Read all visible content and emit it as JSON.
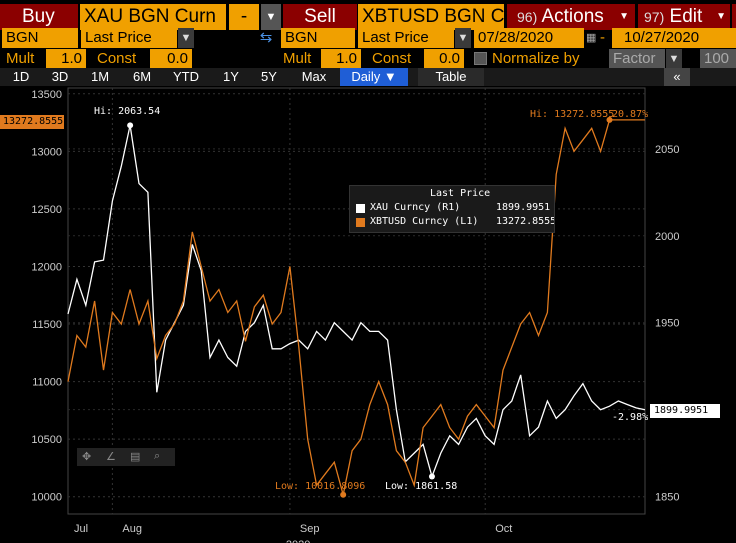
{
  "toprow": {
    "buy_label": "Buy",
    "left_security": "XAU BGN Curn",
    "dash": "-",
    "sell_label": "Sell",
    "right_security": "XBTUSD BGN C",
    "actions_num": "96)",
    "actions_label": "Actions",
    "edit_num": "97)",
    "edit_label": "Edit"
  },
  "row2": {
    "left_source": "BGN",
    "left_field": "Last Price",
    "swap_icon": "swap-arrows-icon",
    "right_source": "BGN",
    "right_field": "Last Price",
    "start_date": "07/28/2020",
    "date_sep": "-",
    "end_date": "10/27/2020"
  },
  "row3": {
    "mult_label_l": "Mult",
    "mult_value_l": "1.0",
    "const_label_l": "Const",
    "const_value_l": "0.0",
    "mult_label_r": "Mult",
    "mult_value_r": "1.0",
    "const_label_r": "Const",
    "const_value_r": "0.0",
    "normalize_label": "Normalize by",
    "normalize_value": "Factor",
    "factor_value": "100"
  },
  "tabs": [
    "1D",
    "3D",
    "1M",
    "6M",
    "YTD",
    "1Y",
    "5Y",
    "Max"
  ],
  "period": "Daily ▼",
  "table_label": "Table",
  "legend": {
    "title": "Last Price",
    "s1": "XAU Curncy  (R1)",
    "v1": "1899.9951",
    "s2": "XBTUSD Curncy  (L1)",
    "v2": "13272.8555"
  },
  "annotations": {
    "hi_xau": "Hi: 2063.54",
    "hi_xbt": "Hi: 13272.8555",
    "pct": "20.87%",
    "low_xbt": "Low: 10016.8096",
    "low_xau": "Low: 1861.58",
    "neg_pct": "-2.98%",
    "last_xbt_tag": "13272.8555",
    "last_xau_tag": "1899.9951"
  },
  "colors": {
    "orange": "#f0a000",
    "red": "#8b0000",
    "xau_line": "#ffffff",
    "xbt_line": "#e07a1e",
    "active_tab": "#1f5ed6"
  },
  "chart_data": {
    "type": "line",
    "x": [
      "Jul 28",
      "Jul 29",
      "Jul 30",
      "Jul 31",
      "Aug 3",
      "Aug 4",
      "Aug 5",
      "Aug 6",
      "Aug 7",
      "Aug 10",
      "Aug 11",
      "Aug 12",
      "Aug 13",
      "Aug 14",
      "Aug 17",
      "Aug 18",
      "Aug 19",
      "Aug 20",
      "Aug 21",
      "Aug 24",
      "Aug 25",
      "Aug 26",
      "Aug 27",
      "Aug 28",
      "Aug 31",
      "Sep 1",
      "Sep 2",
      "Sep 3",
      "Sep 4",
      "Sep 7",
      "Sep 8",
      "Sep 9",
      "Sep 10",
      "Sep 11",
      "Sep 14",
      "Sep 15",
      "Sep 16",
      "Sep 17",
      "Sep 18",
      "Sep 21",
      "Sep 22",
      "Sep 23",
      "Sep 24",
      "Sep 25",
      "Sep 28",
      "Sep 29",
      "Sep 30",
      "Oct 1",
      "Oct 2",
      "Oct 5",
      "Oct 6",
      "Oct 7",
      "Oct 8",
      "Oct 9",
      "Oct 12",
      "Oct 13",
      "Oct 14",
      "Oct 15",
      "Oct 16",
      "Oct 19",
      "Oct 20",
      "Oct 21",
      "Oct 22",
      "Oct 23",
      "Oct 26",
      "Oct 27"
    ],
    "series": [
      {
        "name": "XAU Curncy (R1)",
        "axis": "right",
        "values": [
          1955,
          1975,
          1960,
          1985,
          1986,
          2020,
          2040,
          2063.54,
          2030,
          2025,
          1910,
          1940,
          1950,
          1960,
          1995,
          1980,
          1930,
          1940,
          1930,
          1925,
          1945,
          1950,
          1960,
          1935,
          1935,
          1938,
          1940,
          1935,
          1945,
          1940,
          1950,
          1945,
          1940,
          1950,
          1945,
          1945,
          1940,
          1900,
          1870,
          1875,
          1880,
          1861.58,
          1875,
          1885,
          1880,
          1890,
          1895,
          1885,
          1880,
          1900,
          1905,
          1920,
          1885,
          1890,
          1905,
          1895,
          1900,
          1908,
          1915,
          1905,
          1900,
          1902,
          1905,
          1903,
          1901,
          1899.9951
        ]
      },
      {
        "name": "XBTUSD Curncy (L1)",
        "axis": "left",
        "values": [
          11000,
          11400,
          11300,
          11700,
          11100,
          11600,
          11500,
          11800,
          11500,
          11700,
          11200,
          11400,
          11500,
          11700,
          12300,
          12000,
          11700,
          11800,
          11600,
          11700,
          11350,
          11650,
          11750,
          11500,
          11600,
          12000,
          11300,
          10500,
          10100,
          10200,
          10300,
          10016.8096,
          10400,
          10500,
          10800,
          11000,
          10800,
          10400,
          10300,
          10100,
          10600,
          10700,
          10800,
          10600,
          10500,
          10700,
          10800,
          10700,
          10600,
          11100,
          11300,
          11500,
          11600,
          11400,
          11600,
          12800,
          13200,
          13000,
          13100,
          13200,
          13000,
          13272.8555,
          13272.8555,
          13272.8555,
          13272.8555,
          13272.8555
        ]
      }
    ],
    "y_left": {
      "ticks": [
        10000,
        10500,
        11000,
        11500,
        12000,
        12500,
        13000,
        13500
      ],
      "ylim": [
        9850,
        13550
      ]
    },
    "y_right": {
      "ticks": [
        1850,
        1900,
        1950,
        2000,
        2050
      ],
      "ylim": [
        1840,
        2085
      ]
    },
    "x_labels": [
      "Jul",
      "Aug",
      "Sep",
      "Oct"
    ],
    "x_sublabel": "2020",
    "grid": true,
    "legend": "top-center"
  }
}
